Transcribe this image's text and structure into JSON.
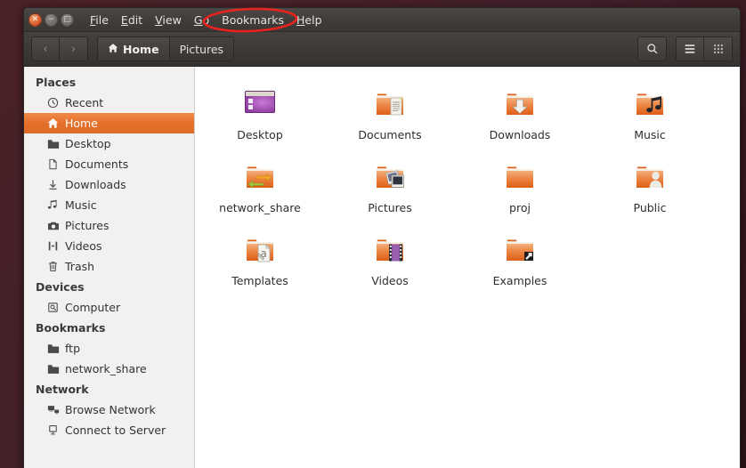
{
  "window": {
    "controls": [
      {
        "name": "close",
        "glyph": "✕"
      },
      {
        "name": "minimize",
        "glyph": "−"
      },
      {
        "name": "maximize",
        "glyph": "□"
      }
    ]
  },
  "menubar": {
    "items": [
      {
        "label": "File",
        "mnemonic": "F"
      },
      {
        "label": "Edit",
        "mnemonic": "E"
      },
      {
        "label": "View",
        "mnemonic": "V"
      },
      {
        "label": "Go",
        "mnemonic": "G"
      },
      {
        "label": "Bookmarks",
        "mnemonic": "B"
      },
      {
        "label": "Help",
        "mnemonic": "H"
      }
    ]
  },
  "annotation": {
    "target": "Bookmarks",
    "shape": "ellipse",
    "color": "#e8221c"
  },
  "toolbar": {
    "back_label": "‹",
    "forward_label": "›",
    "search_icon": "search-icon",
    "list_view_icon": "list-view-icon",
    "grid_view_icon": "grid-view-icon",
    "breadcrumbs": [
      {
        "label": "Home",
        "icon": "home-icon",
        "active": true
      },
      {
        "label": "Pictures",
        "icon": "",
        "active": false
      }
    ]
  },
  "sidebar": {
    "sections": [
      {
        "title": "Places",
        "items": [
          {
            "label": "Recent",
            "icon": "clock-icon",
            "selected": false
          },
          {
            "label": "Home",
            "icon": "home-icon",
            "selected": true
          },
          {
            "label": "Desktop",
            "icon": "folder-icon",
            "selected": false
          },
          {
            "label": "Documents",
            "icon": "document-icon",
            "selected": false
          },
          {
            "label": "Downloads",
            "icon": "download-icon",
            "selected": false
          },
          {
            "label": "Music",
            "icon": "music-icon",
            "selected": false
          },
          {
            "label": "Pictures",
            "icon": "camera-icon",
            "selected": false
          },
          {
            "label": "Videos",
            "icon": "film-icon",
            "selected": false
          },
          {
            "label": "Trash",
            "icon": "trash-icon",
            "selected": false
          }
        ]
      },
      {
        "title": "Devices",
        "items": [
          {
            "label": "Computer",
            "icon": "computer-icon",
            "selected": false
          }
        ]
      },
      {
        "title": "Bookmarks",
        "items": [
          {
            "label": "ftp",
            "icon": "folder-icon",
            "selected": false
          },
          {
            "label": "network_share",
            "icon": "folder-icon",
            "selected": false
          }
        ]
      },
      {
        "title": "Network",
        "items": [
          {
            "label": "Browse Network",
            "icon": "network-icon",
            "selected": false
          },
          {
            "label": "Connect to Server",
            "icon": "server-icon",
            "selected": false
          }
        ]
      }
    ]
  },
  "content": {
    "rows": [
      [
        {
          "label": "Desktop",
          "icon": "desktop-folder-icon"
        },
        {
          "label": "Documents",
          "icon": "documents-folder-icon"
        },
        {
          "label": "Downloads",
          "icon": "downloads-folder-icon"
        },
        {
          "label": "Music",
          "icon": "music-folder-icon"
        }
      ],
      [
        {
          "label": "network_share",
          "icon": "share-folder-icon"
        },
        {
          "label": "Pictures",
          "icon": "pictures-folder-icon"
        },
        {
          "label": "proj",
          "icon": "plain-folder-icon"
        },
        {
          "label": "Public",
          "icon": "public-folder-icon"
        }
      ],
      [
        {
          "label": "Templates",
          "icon": "templates-folder-icon"
        },
        {
          "label": "Videos",
          "icon": "videos-folder-icon"
        },
        {
          "label": "Examples",
          "icon": "examples-folder-icon"
        }
      ]
    ]
  },
  "colors": {
    "accent_orange": "#e4702a",
    "folder_orange": "#e8761f",
    "desktop_purple": "#8e3f9e",
    "annotation_red": "#e8221c",
    "sidebar_bg": "#f2f1f0",
    "chrome_dark": "#3c3937"
  }
}
